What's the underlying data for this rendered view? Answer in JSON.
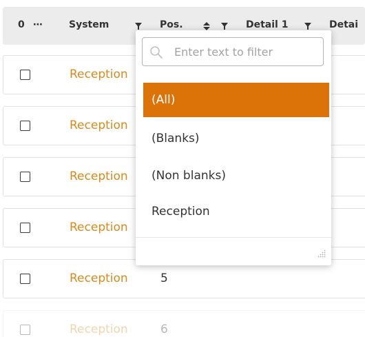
{
  "header": {
    "count_label": "0",
    "more_label": "⋯",
    "columns": [
      {
        "label": "System"
      },
      {
        "label": "Pos."
      },
      {
        "label": "Detail 1"
      },
      {
        "label": "Detai"
      }
    ]
  },
  "rows": [
    {
      "system": "Reception",
      "pos": ""
    },
    {
      "system": "Reception",
      "pos": ""
    },
    {
      "system": "Reception",
      "pos": ""
    },
    {
      "system": "Reception",
      "pos": ""
    },
    {
      "system": "Reception",
      "pos": "5"
    },
    {
      "system": "Reception",
      "pos": "6"
    }
  ],
  "filter_popup": {
    "search_placeholder": "Enter text to filter",
    "search_value": "",
    "options": [
      {
        "label": "(All)",
        "selected": true
      },
      {
        "label": "(Blanks)",
        "selected": false
      },
      {
        "label": "(Non blanks)",
        "selected": false
      },
      {
        "label": "Reception",
        "selected": false
      }
    ]
  },
  "colors": {
    "accent": "#dc7309",
    "link_text": "#d68a1b",
    "header_bg": "#ececec"
  },
  "icons": [
    "filter-icon",
    "sort-icon",
    "search-icon",
    "resize-grip-icon",
    "more-icon"
  ]
}
